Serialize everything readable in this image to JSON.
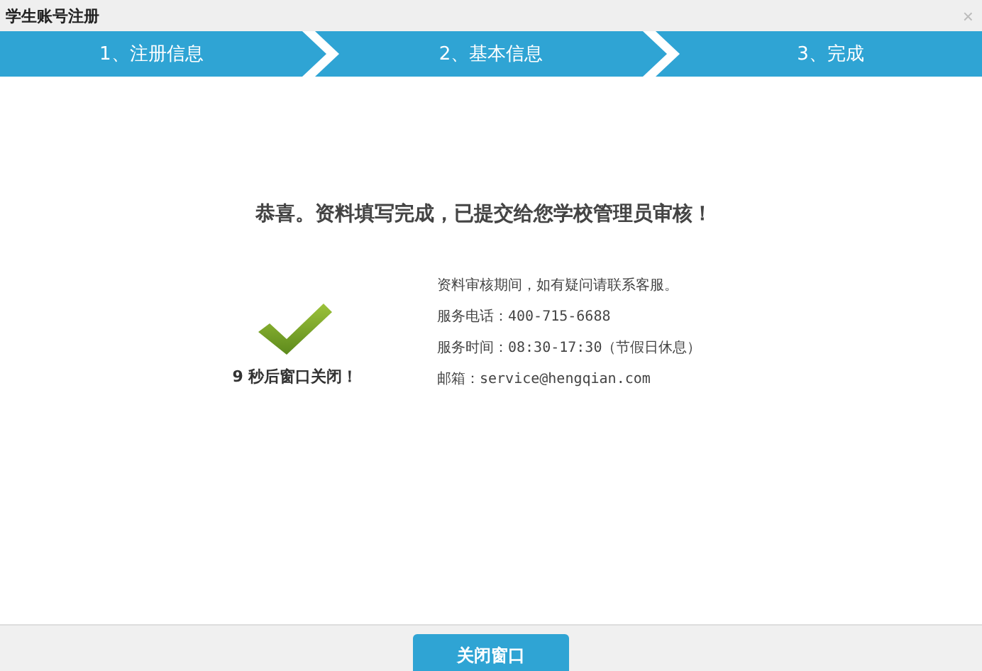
{
  "window": {
    "title": "学生账号注册",
    "close": "×"
  },
  "steps": [
    {
      "label": "1、注册信息"
    },
    {
      "label": "2、基本信息"
    },
    {
      "label": "3、完成"
    }
  ],
  "message": "恭喜。资料填写完成，已提交给您学校管理员审核！",
  "countdown": "9 秒后窗口关闭！",
  "info": [
    "资料审核期间，如有疑问请联系客服。",
    "服务电话：400-715-6688",
    "服务时间：08:30-17:30（节假日休息）",
    "邮箱：service@hengqian.com"
  ],
  "button": "关闭窗口"
}
